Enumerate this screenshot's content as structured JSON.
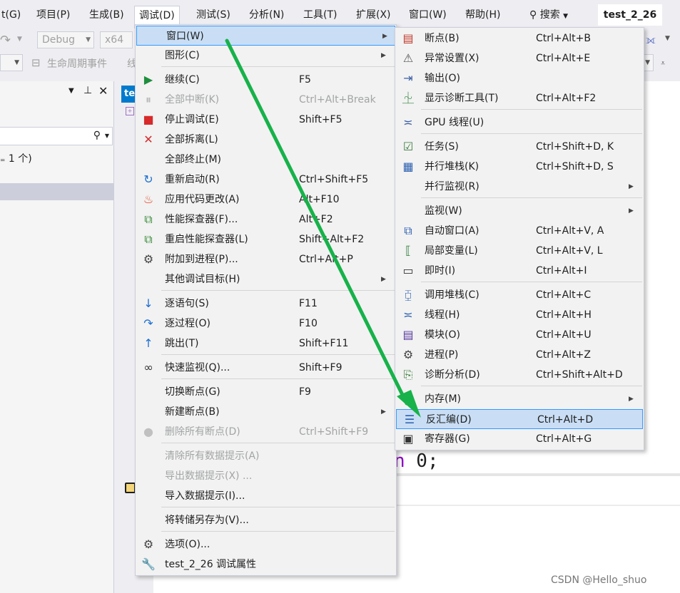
{
  "menubar": {
    "items": [
      "t(G)",
      "项目(P)",
      "生成(B)",
      "调试(D)",
      "测试(S)",
      "分析(N)",
      "工具(T)",
      "扩展(X)",
      "窗口(W)",
      "帮助(H)"
    ],
    "search_label": "搜索",
    "solution_title": "test_2_26"
  },
  "toolbar": {
    "config": "Debug",
    "platform": "x64",
    "lifecycle": "生命周期事件",
    "extra": "线"
  },
  "left_panel": {
    "status": "₌ 1 个)"
  },
  "editor": {
    "tab_label": "te",
    "code_keyword": "n",
    "code_rest": " 0;"
  },
  "debug_menu": [
    {
      "label": "窗口(W)",
      "shortcut": "",
      "submenu": true,
      "icon": "",
      "highlighted": true
    },
    {
      "label": "图形(C)",
      "shortcut": "",
      "submenu": true,
      "icon": ""
    },
    {
      "label": "继续(C)",
      "shortcut": "F5",
      "icon": "play-icon"
    },
    {
      "label": "全部中断(K)",
      "shortcut": "Ctrl+Alt+Break",
      "icon": "pause-icon",
      "disabled": true
    },
    {
      "label": "停止调试(E)",
      "shortcut": "Shift+F5",
      "icon": "stop-icon"
    },
    {
      "label": "全部拆离(L)",
      "shortcut": "",
      "icon": "detach-icon"
    },
    {
      "label": "全部终止(M)",
      "shortcut": "",
      "icon": ""
    },
    {
      "label": "重新启动(R)",
      "shortcut": "Ctrl+Shift+F5",
      "icon": "restart-icon"
    },
    {
      "label": "应用代码更改(A)",
      "shortcut": "Alt+F10",
      "icon": "hot-reload-icon"
    },
    {
      "label": "性能探查器(F)...",
      "shortcut": "Alt+F2",
      "icon": "profiler-icon"
    },
    {
      "label": "重启性能探查器(L)",
      "shortcut": "Shift+Alt+F2",
      "icon": "profiler-restart-icon"
    },
    {
      "label": "附加到进程(P)...",
      "shortcut": "Ctrl+Alt+P",
      "icon": "attach-process-icon"
    },
    {
      "label": "其他调试目标(H)",
      "shortcut": "",
      "submenu": true,
      "icon": ""
    },
    {
      "label": "逐语句(S)",
      "shortcut": "F11",
      "icon": "step-into-icon"
    },
    {
      "label": "逐过程(O)",
      "shortcut": "F10",
      "icon": "step-over-icon"
    },
    {
      "label": "跳出(T)",
      "shortcut": "Shift+F11",
      "icon": "step-out-icon"
    },
    {
      "label": "快速监视(Q)...",
      "shortcut": "Shift+F9",
      "icon": "quickwatch-icon"
    },
    {
      "label": "切换断点(G)",
      "shortcut": "F9",
      "icon": ""
    },
    {
      "label": "新建断点(B)",
      "shortcut": "",
      "submenu": true,
      "icon": ""
    },
    {
      "label": "删除所有断点(D)",
      "shortcut": "Ctrl+Shift+F9",
      "icon": "delete-breakpoints-icon",
      "disabled": true
    },
    {
      "label": "清除所有数据提示(A)",
      "shortcut": "",
      "icon": "",
      "disabled": true
    },
    {
      "label": "导出数据提示(X) ...",
      "shortcut": "",
      "icon": "",
      "disabled": true
    },
    {
      "label": "导入数据提示(I)...",
      "shortcut": "",
      "icon": ""
    },
    {
      "label": "将转储另存为(V)...",
      "shortcut": "",
      "icon": ""
    },
    {
      "label": "选项(O)...",
      "shortcut": "",
      "icon": "gear-icon"
    },
    {
      "label": "test_2_26 调试属性",
      "shortcut": "",
      "icon": "wrench-icon"
    }
  ],
  "window_submenu": [
    {
      "label": "断点(B)",
      "shortcut": "Ctrl+Alt+B",
      "icon": "breakpoints-window-icon"
    },
    {
      "label": "异常设置(X)",
      "shortcut": "Ctrl+Alt+E",
      "icon": "exception-settings-icon"
    },
    {
      "label": "输出(O)",
      "shortcut": "",
      "icon": "output-icon"
    },
    {
      "label": "显示诊断工具(T)",
      "shortcut": "Ctrl+Alt+F2",
      "icon": "diagnostic-tools-icon"
    },
    {
      "label": "GPU 线程(U)",
      "shortcut": "",
      "icon": "gpu-threads-icon"
    },
    {
      "label": "任务(S)",
      "shortcut": "Ctrl+Shift+D, K",
      "icon": "tasks-icon"
    },
    {
      "label": "并行堆栈(K)",
      "shortcut": "Ctrl+Shift+D, S",
      "icon": "parallel-stacks-icon"
    },
    {
      "label": "并行监视(R)",
      "shortcut": "",
      "submenu": true,
      "icon": ""
    },
    {
      "label": "监视(W)",
      "shortcut": "",
      "submenu": true,
      "icon": ""
    },
    {
      "label": "自动窗口(A)",
      "shortcut": "Ctrl+Alt+V, A",
      "icon": "autos-icon"
    },
    {
      "label": "局部变量(L)",
      "shortcut": "Ctrl+Alt+V, L",
      "icon": "locals-icon"
    },
    {
      "label": "即时(I)",
      "shortcut": "Ctrl+Alt+I",
      "icon": "immediate-icon"
    },
    {
      "label": "调用堆栈(C)",
      "shortcut": "Ctrl+Alt+C",
      "icon": "call-stack-icon"
    },
    {
      "label": "线程(H)",
      "shortcut": "Ctrl+Alt+H",
      "icon": "threads-icon"
    },
    {
      "label": "模块(O)",
      "shortcut": "Ctrl+Alt+U",
      "icon": "modules-icon"
    },
    {
      "label": "进程(P)",
      "shortcut": "Ctrl+Alt+Z",
      "icon": "processes-icon"
    },
    {
      "label": "诊断分析(D)",
      "shortcut": "Ctrl+Shift+Alt+D",
      "icon": "diagnostic-analysis-icon"
    },
    {
      "label": "内存(M)",
      "shortcut": "",
      "submenu": true,
      "icon": ""
    },
    {
      "label": "反汇编(D)",
      "shortcut": "Ctrl+Alt+D",
      "icon": "disassembly-icon",
      "highlighted": true
    },
    {
      "label": "寄存器(G)",
      "shortcut": "Ctrl+Alt+G",
      "icon": "registers-icon"
    }
  ],
  "watermark": "CSDN @Hello_shuo"
}
